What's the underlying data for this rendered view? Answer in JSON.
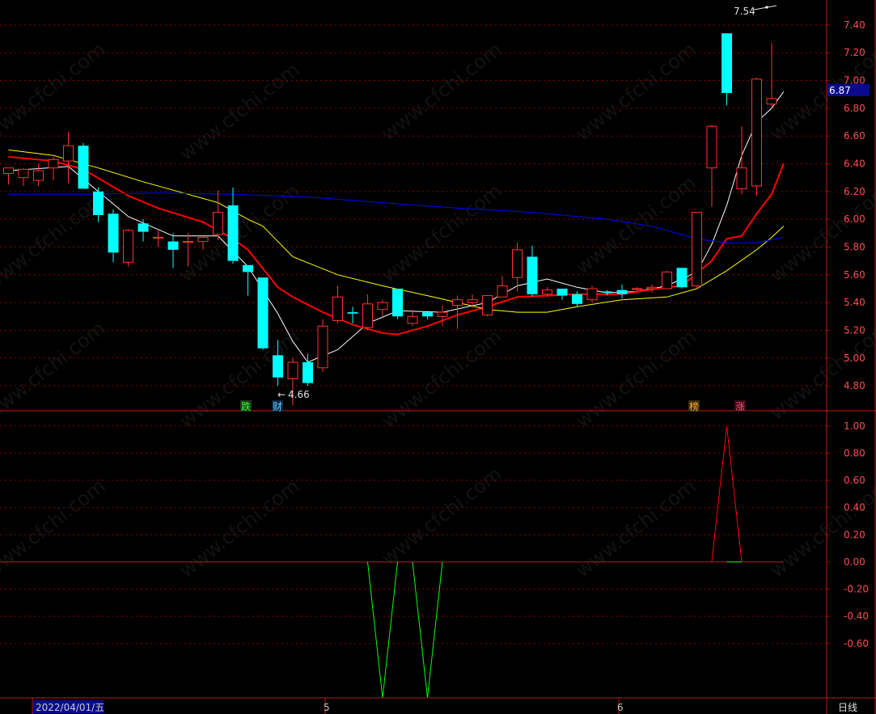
{
  "colors": {
    "up": "#ff3232",
    "down": "#00ffff",
    "ma5": "#ffffff",
    "ma10": "#ff0000",
    "ma20": "#ffff00",
    "ma60": "#0000ff",
    "grid": "#8b0000",
    "axis_text": "#ff4d4d",
    "osc_up": "#ff0000",
    "osc_down": "#00ff00"
  },
  "watermark": "www.cfchi.com",
  "price_badge": "6.87",
  "bottom_bar": {
    "start_date": "2022/04/01/五",
    "month_5": "5",
    "month_6": "6",
    "period": "日线"
  },
  "chart_data": [
    {
      "type": "candlestick",
      "title": "",
      "y_ticks": [
        "7.40",
        "7.20",
        "7.00",
        "6.80",
        "6.60",
        "6.40",
        "6.20",
        "6.00",
        "5.80",
        "5.60",
        "5.40",
        "5.20",
        "5.00",
        "4.80"
      ],
      "ylim": [
        4.62,
        7.58
      ],
      "grid": true,
      "annotations": {
        "high": "7.54",
        "low": "4.66"
      },
      "markers": [
        "跌",
        "财",
        "榜",
        "涨"
      ],
      "candles": [
        {
          "o": 6.33,
          "h": 6.36,
          "l": 6.25,
          "c": 6.37
        },
        {
          "o": 6.3,
          "h": 6.37,
          "l": 6.24,
          "c": 6.36
        },
        {
          "o": 6.28,
          "h": 6.4,
          "l": 6.24,
          "c": 6.35
        },
        {
          "o": 6.37,
          "h": 6.45,
          "l": 6.28,
          "c": 6.43
        },
        {
          "o": 6.42,
          "h": 6.63,
          "l": 6.26,
          "c": 6.53
        },
        {
          "o": 6.53,
          "h": 6.55,
          "l": 6.22,
          "c": 6.22
        },
        {
          "o": 6.2,
          "h": 6.23,
          "l": 5.98,
          "c": 6.03
        },
        {
          "o": 6.04,
          "h": 6.07,
          "l": 5.69,
          "c": 5.76
        },
        {
          "o": 5.69,
          "h": 5.93,
          "l": 5.66,
          "c": 5.92
        },
        {
          "o": 5.97,
          "h": 6.0,
          "l": 5.84,
          "c": 5.91
        },
        {
          "o": 5.87,
          "h": 5.92,
          "l": 5.8,
          "c": 5.87
        },
        {
          "o": 5.84,
          "h": 5.9,
          "l": 5.65,
          "c": 5.78
        },
        {
          "o": 5.84,
          "h": 5.9,
          "l": 5.66,
          "c": 5.84
        },
        {
          "o": 5.84,
          "h": 5.88,
          "l": 5.78,
          "c": 5.87
        },
        {
          "o": 5.89,
          "h": 6.21,
          "l": 5.85,
          "c": 6.05
        },
        {
          "o": 6.1,
          "h": 6.23,
          "l": 5.68,
          "c": 5.7
        },
        {
          "o": 5.67,
          "h": 5.67,
          "l": 5.45,
          "c": 5.62
        },
        {
          "o": 5.58,
          "h": 5.58,
          "l": 5.06,
          "c": 5.07
        },
        {
          "o": 5.02,
          "h": 5.13,
          "l": 4.8,
          "c": 4.86
        },
        {
          "o": 4.85,
          "h": 5.0,
          "l": 4.66,
          "c": 4.97
        },
        {
          "o": 4.97,
          "h": 5.03,
          "l": 4.8,
          "c": 4.82
        },
        {
          "o": 4.93,
          "h": 5.28,
          "l": 4.9,
          "c": 5.23
        },
        {
          "o": 5.27,
          "h": 5.52,
          "l": 5.25,
          "c": 5.44
        },
        {
          "o": 5.33,
          "h": 5.37,
          "l": 5.25,
          "c": 5.32
        },
        {
          "o": 5.22,
          "h": 5.46,
          "l": 5.2,
          "c": 5.39
        },
        {
          "o": 5.35,
          "h": 5.42,
          "l": 5.3,
          "c": 5.4
        },
        {
          "o": 5.5,
          "h": 5.5,
          "l": 5.28,
          "c": 5.3
        },
        {
          "o": 5.25,
          "h": 5.35,
          "l": 5.23,
          "c": 5.3
        },
        {
          "o": 5.33,
          "h": 5.33,
          "l": 5.28,
          "c": 5.3
        },
        {
          "o": 5.3,
          "h": 5.38,
          "l": 5.23,
          "c": 5.33
        },
        {
          "o": 5.38,
          "h": 5.45,
          "l": 5.21,
          "c": 5.42
        },
        {
          "o": 5.4,
          "h": 5.46,
          "l": 5.36,
          "c": 5.42
        },
        {
          "o": 5.31,
          "h": 5.45,
          "l": 5.3,
          "c": 5.45
        },
        {
          "o": 5.44,
          "h": 5.59,
          "l": 5.44,
          "c": 5.52
        },
        {
          "o": 5.58,
          "h": 5.83,
          "l": 5.48,
          "c": 5.78
        },
        {
          "o": 5.73,
          "h": 5.81,
          "l": 5.44,
          "c": 5.46
        },
        {
          "o": 5.46,
          "h": 5.51,
          "l": 5.44,
          "c": 5.49
        },
        {
          "o": 5.5,
          "h": 5.5,
          "l": 5.42,
          "c": 5.45
        },
        {
          "o": 5.46,
          "h": 5.48,
          "l": 5.37,
          "c": 5.39
        },
        {
          "o": 5.42,
          "h": 5.52,
          "l": 5.4,
          "c": 5.5
        },
        {
          "o": 5.48,
          "h": 5.49,
          "l": 5.45,
          "c": 5.47
        },
        {
          "o": 5.49,
          "h": 5.53,
          "l": 5.43,
          "c": 5.46
        },
        {
          "o": 5.5,
          "h": 5.51,
          "l": 5.47,
          "c": 5.5
        },
        {
          "o": 5.5,
          "h": 5.53,
          "l": 5.47,
          "c": 5.51
        },
        {
          "o": 5.5,
          "h": 5.63,
          "l": 5.5,
          "c": 5.62
        },
        {
          "o": 5.65,
          "h": 5.65,
          "l": 5.5,
          "c": 5.51
        },
        {
          "o": 5.52,
          "h": 6.05,
          "l": 5.5,
          "c": 6.05
        },
        {
          "o": 6.37,
          "h": 6.68,
          "l": 6.09,
          "c": 6.67
        },
        {
          "o": 7.34,
          "h": 7.34,
          "l": 6.82,
          "c": 6.91
        },
        {
          "o": 6.22,
          "h": 6.67,
          "l": 6.18,
          "c": 6.37
        },
        {
          "o": 6.24,
          "h": 7.02,
          "l": 6.17,
          "c": 7.01
        },
        {
          "o": 6.83,
          "h": 7.27,
          "l": 6.8,
          "c": 6.87
        }
      ],
      "ma": {
        "MA5": {
          "color_key": "ma5",
          "points": [
            [
              0,
              6.35
            ],
            [
              4,
              6.38
            ],
            [
              6,
              6.2
            ],
            [
              8,
              6.02
            ],
            [
              11,
              5.88
            ],
            [
              14,
              5.88
            ],
            [
              16,
              5.66
            ],
            [
              18,
              5.32
            ],
            [
              19,
              5.12
            ],
            [
              20,
              4.97
            ],
            [
              22,
              5.06
            ],
            [
              24,
              5.25
            ],
            [
              26,
              5.34
            ],
            [
              29,
              5.33
            ],
            [
              32,
              5.4
            ],
            [
              34,
              5.52
            ],
            [
              36,
              5.57
            ],
            [
              38,
              5.51
            ],
            [
              40,
              5.47
            ],
            [
              42,
              5.48
            ],
            [
              44,
              5.52
            ],
            [
              46,
              5.62
            ],
            [
              47,
              5.82
            ],
            [
              48,
              6.1
            ],
            [
              49,
              6.46
            ],
            [
              50,
              6.7
            ],
            [
              51,
              6.8
            ],
            [
              51.8,
              6.92
            ]
          ]
        },
        "MA10": {
          "color_key": "ma10",
          "points": [
            [
              0,
              6.45
            ],
            [
              3,
              6.42
            ],
            [
              5,
              6.36
            ],
            [
              8,
              6.17
            ],
            [
              10,
              6.08
            ],
            [
              13,
              5.98
            ],
            [
              15,
              5.86
            ],
            [
              16,
              5.78
            ],
            [
              18,
              5.51
            ],
            [
              19,
              5.44
            ],
            [
              21,
              5.33
            ],
            [
              23,
              5.24
            ],
            [
              25,
              5.18
            ],
            [
              26,
              5.17
            ],
            [
              28,
              5.23
            ],
            [
              30,
              5.31
            ],
            [
              32,
              5.37
            ],
            [
              34,
              5.44
            ],
            [
              36,
              5.45
            ],
            [
              38,
              5.46
            ],
            [
              41,
              5.46
            ],
            [
              44,
              5.51
            ],
            [
              45,
              5.52
            ],
            [
              47,
              5.7
            ],
            [
              48,
              5.86
            ],
            [
              49,
              5.88
            ],
            [
              50,
              6.04
            ],
            [
              51,
              6.18
            ],
            [
              51.8,
              6.4
            ]
          ]
        },
        "MA20": {
          "color_key": "ma20",
          "points": [
            [
              0,
              6.5
            ],
            [
              3,
              6.46
            ],
            [
              6,
              6.37
            ],
            [
              9,
              6.27
            ],
            [
              12,
              6.18
            ],
            [
              14,
              6.12
            ],
            [
              16,
              6.0
            ],
            [
              17,
              5.95
            ],
            [
              19,
              5.73
            ],
            [
              22,
              5.6
            ],
            [
              25,
              5.52
            ],
            [
              28,
              5.45
            ],
            [
              30,
              5.4
            ],
            [
              32,
              5.35
            ],
            [
              34,
              5.33
            ],
            [
              36,
              5.33
            ],
            [
              38,
              5.37
            ],
            [
              41,
              5.42
            ],
            [
              44,
              5.44
            ],
            [
              46,
              5.5
            ],
            [
              48,
              5.63
            ],
            [
              50,
              5.78
            ],
            [
              51,
              5.87
            ],
            [
              51.8,
              5.95
            ]
          ]
        },
        "MA60": {
          "color_key": "ma60",
          "points": [
            [
              0,
              6.18
            ],
            [
              5,
              6.18
            ],
            [
              10,
              6.19
            ],
            [
              15,
              6.18
            ],
            [
              20,
              6.16
            ],
            [
              25,
              6.12
            ],
            [
              30,
              6.08
            ],
            [
              35,
              6.05
            ],
            [
              40,
              6.0
            ],
            [
              43,
              5.95
            ],
            [
              46,
              5.86
            ],
            [
              48,
              5.83
            ],
            [
              50,
              5.83
            ],
            [
              51.8,
              5.87
            ]
          ]
        }
      }
    },
    {
      "type": "line",
      "y_ticks": [
        "1.00",
        "0.80",
        "0.60",
        "0.40",
        "0.20",
        "0.00",
        "-0.20",
        "-0.40",
        "-0.60"
      ],
      "ylim": [
        -1.0,
        1.1
      ],
      "grid": true,
      "series": [
        {
          "color_key": "osc_down",
          "points": [
            [
              24,
              0
            ],
            [
              25,
              -1
            ],
            [
              26,
              0
            ]
          ]
        },
        {
          "color_key": "osc_down",
          "points": [
            [
              27,
              0
            ],
            [
              28,
              -1
            ],
            [
              29,
              0
            ]
          ]
        },
        {
          "color_key": "osc_up",
          "points": [
            [
              47,
              0
            ],
            [
              48,
              1
            ],
            [
              49,
              0
            ]
          ]
        }
      ],
      "baseline": 0
    }
  ]
}
